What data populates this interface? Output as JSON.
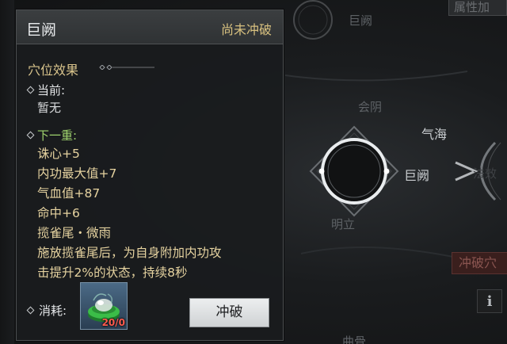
{
  "background": {
    "top_node_label": "巨阙",
    "label_yinjiao": "会阴",
    "label_qihai": "气海",
    "selected_node_label": "巨阙",
    "label_bottom": "明立",
    "label_bottom_right": "曲骨",
    "top_right_tab": "属性加",
    "side_text": "法效",
    "breakthrough_tab": "冲破穴",
    "info_button": "i"
  },
  "panel": {
    "title": "巨阙",
    "status": "尚未冲破",
    "section_title": "穴位效果",
    "current_label": "当前:",
    "current_value": "暂无",
    "next_label": "下一重:",
    "next_effects": [
      "诛心+5",
      "内功最大值+7",
      "气血值+87",
      "命中+6",
      "揽雀尾・微雨"
    ],
    "skill_desc_line1": "施放揽雀尾后，为自身附加内功攻",
    "skill_desc_line2": "击提升2%的状态，持续8秒",
    "cost_label": "消耗:",
    "cost_count": "20/0",
    "confirm_button": "冲破"
  },
  "colors": {
    "gold_text": "#e6d3a0",
    "green_label": "#9fd36e",
    "status_gold": "#d7c07f",
    "cost_count_red": "#ff5b4e"
  },
  "icons": [
    "diamond-bullet-icon",
    "acupoint-ring-icon",
    "jade-item-icon",
    "info-icon"
  ]
}
